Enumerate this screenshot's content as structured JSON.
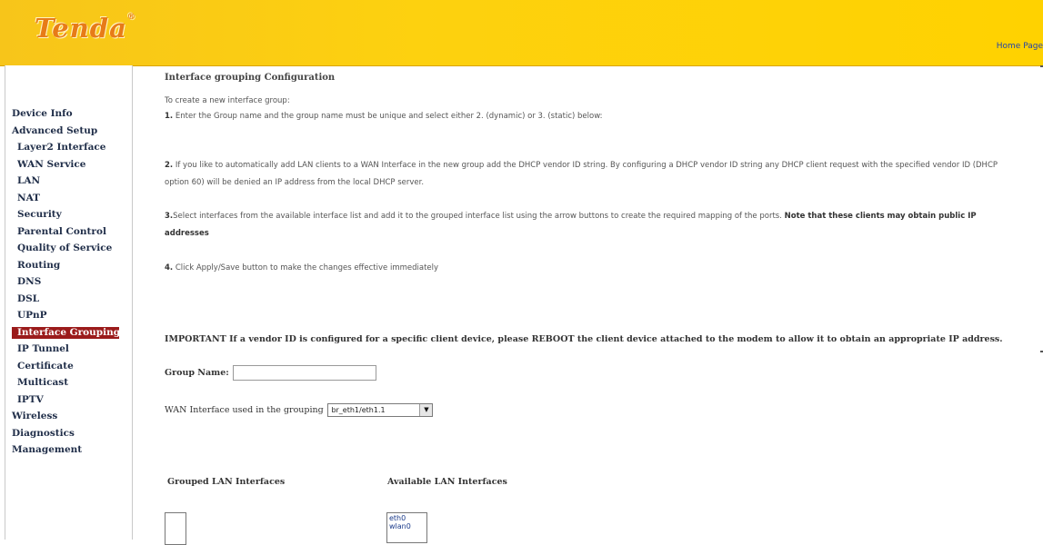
{
  "header": {
    "logo": "Tenda",
    "logo_mark": "®",
    "home_link": "Home Page"
  },
  "sidebar": {
    "items": [
      {
        "label": "Device Info",
        "level": "top"
      },
      {
        "label": "Advanced Setup",
        "level": "top"
      },
      {
        "label": "Layer2 Interface",
        "level": "sub"
      },
      {
        "label": "WAN Service",
        "level": "sub"
      },
      {
        "label": "LAN",
        "level": "sub"
      },
      {
        "label": "NAT",
        "level": "sub"
      },
      {
        "label": "Security",
        "level": "sub"
      },
      {
        "label": "Parental Control",
        "level": "sub"
      },
      {
        "label": "Quality of Service",
        "level": "sub"
      },
      {
        "label": "Routing",
        "level": "sub"
      },
      {
        "label": "DNS",
        "level": "sub"
      },
      {
        "label": "DSL",
        "level": "sub"
      },
      {
        "label": "UPnP",
        "level": "sub"
      },
      {
        "label": "Interface Grouping",
        "level": "sub",
        "active": true
      },
      {
        "label": "IP Tunnel",
        "level": "sub"
      },
      {
        "label": "Certificate",
        "level": "sub"
      },
      {
        "label": "Multicast",
        "level": "sub"
      },
      {
        "label": "IPTV",
        "level": "sub"
      },
      {
        "label": "Wireless",
        "level": "top"
      },
      {
        "label": "Diagnostics",
        "level": "top"
      },
      {
        "label": "Management",
        "level": "top"
      }
    ]
  },
  "main": {
    "title": "Interface grouping Configuration",
    "intro": "To create a new interface group:",
    "step1_num": "1.",
    "step1": "Enter the Group name and the group name must be unique and select either 2. (dynamic) or 3. (static) below:",
    "step2_num": "2.",
    "step2": "If you like to automatically add LAN clients to a WAN Interface in the new group add the DHCP vendor ID string. By configuring a DHCP vendor ID string any DHCP client request with the specified vendor ID (DHCP option 60) will be denied an IP address from the local DHCP server.",
    "step3_num": "3.",
    "step3": "Select interfaces from the available interface list and add it to the grouped interface list using the arrow buttons to create the required mapping of the ports.",
    "step3_bold": "Note that these clients may obtain public IP addresses",
    "step4_num": "4.",
    "step4": "Click Apply/Save button to make the changes effective immediately",
    "important": "IMPORTANT If a vendor ID is configured for a specific client device, please REBOOT the client device attached to the modem to allow it to obtain an appropriate IP address.",
    "group_name_label": "Group Name:",
    "group_name_value": "",
    "wan_label": "WAN Interface used in the grouping",
    "wan_selected": "br_eth1/eth1.1",
    "grouped_label": "Grouped LAN Interfaces",
    "available_label": "Available LAN Interfaces",
    "grouped_items": [],
    "available_items": [
      "eth0",
      "wlan0"
    ]
  },
  "colors": {
    "header_bg": "#ffd200",
    "logo": "#e77b18",
    "active_nav": "#9b1b1b"
  }
}
